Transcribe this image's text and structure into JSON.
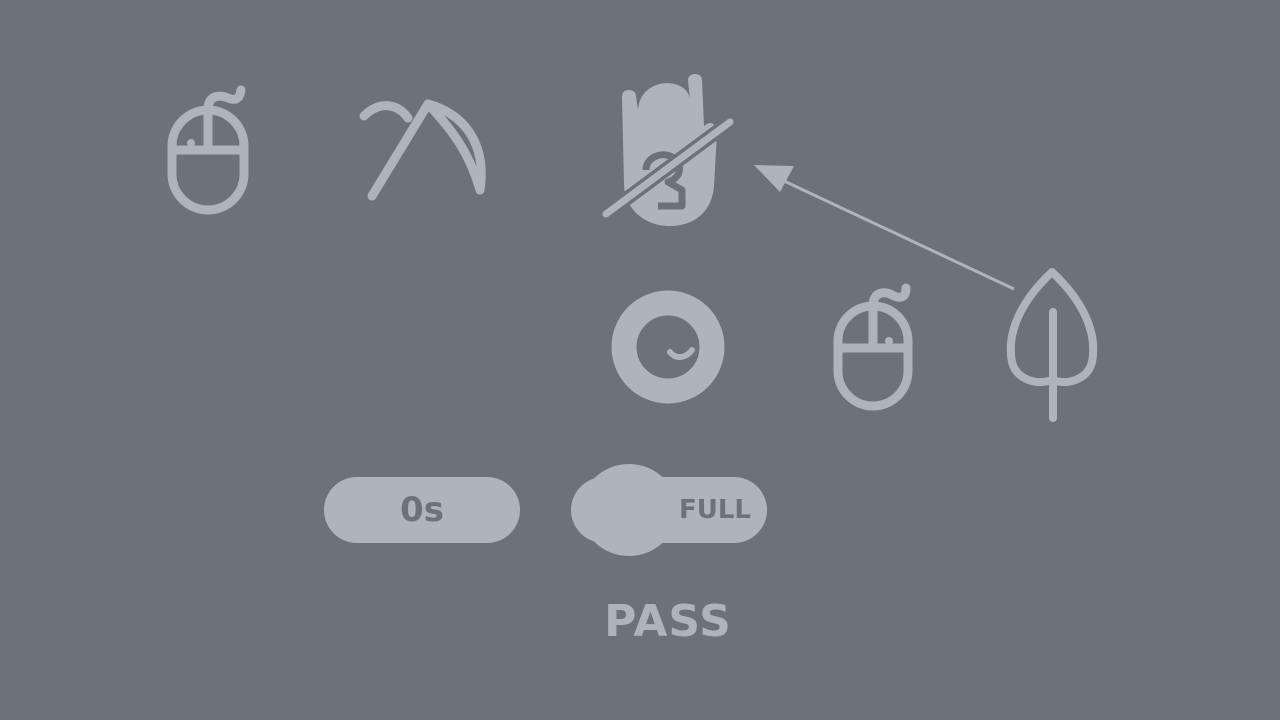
{
  "colors": {
    "background": "#6b727c",
    "foreground": "#aeb4bb"
  },
  "icons": {
    "row1": [
      "mouse-icon",
      "scythe-icon",
      "hand-off-icon"
    ],
    "row2": [
      "circle-smile-icon",
      "mouse-icon",
      "leaf-icon"
    ],
    "pointer": "arrow-icon"
  },
  "hud": {
    "timer": "0s",
    "mode_toggle": "FULL",
    "result": "PASS"
  }
}
